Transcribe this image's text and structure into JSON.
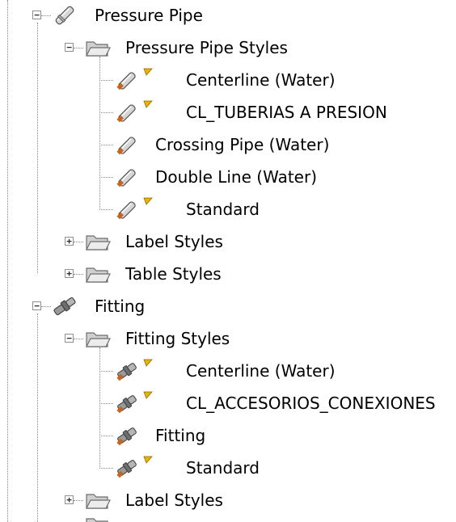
{
  "tree": {
    "pressure_pipe": {
      "label": "Pressure Pipe",
      "icon": "pressure-pipe-icon",
      "expanded": true,
      "styles_folder": {
        "label": "Pressure Pipe Styles",
        "icon": "folder-open-icon",
        "expanded": true,
        "items": [
          {
            "label": "Centerline (Water)",
            "icon": "pressure-pipe-style-icon",
            "flagged": true
          },
          {
            "label": "CL_TUBERIAS A PRESION",
            "icon": "pressure-pipe-style-icon",
            "flagged": true
          },
          {
            "label": "Crossing Pipe (Water)",
            "icon": "pressure-pipe-style-icon",
            "flagged": false
          },
          {
            "label": "Double Line (Water)",
            "icon": "pressure-pipe-style-icon",
            "flagged": false
          },
          {
            "label": "Standard",
            "icon": "pressure-pipe-style-icon",
            "flagged": true
          }
        ]
      },
      "label_styles": {
        "label": "Label Styles",
        "icon": "folder-icon",
        "expanded": false
      },
      "table_styles": {
        "label": "Table Styles",
        "icon": "folder-icon",
        "expanded": false
      }
    },
    "fitting": {
      "label": "Fitting",
      "icon": "fitting-icon",
      "expanded": true,
      "styles_folder": {
        "label": "Fitting Styles",
        "icon": "folder-open-icon",
        "expanded": true,
        "items": [
          {
            "label": "Centerline (Water)",
            "icon": "fitting-style-icon",
            "flagged": true
          },
          {
            "label": "CL_ACCESORIOS_CONEXIONES",
            "icon": "fitting-style-icon",
            "flagged": true
          },
          {
            "label": "Fitting",
            "icon": "fitting-style-icon",
            "flagged": false
          },
          {
            "label": "Standard",
            "icon": "fitting-style-icon",
            "flagged": true
          }
        ]
      },
      "label_styles": {
        "label": "Label Styles",
        "icon": "folder-icon",
        "expanded": false
      }
    }
  },
  "toggle_symbols": {
    "expanded": "−",
    "collapsed": "+"
  },
  "colors": {
    "background": "#ffffff",
    "text": "#000000",
    "tree_lines": "#8c8c8c",
    "folder_fill": "#d9d9d9",
    "folder_stroke": "#6e6e6e",
    "flag_fill": "#e8b400",
    "pipe_orange": "#c8641e"
  }
}
